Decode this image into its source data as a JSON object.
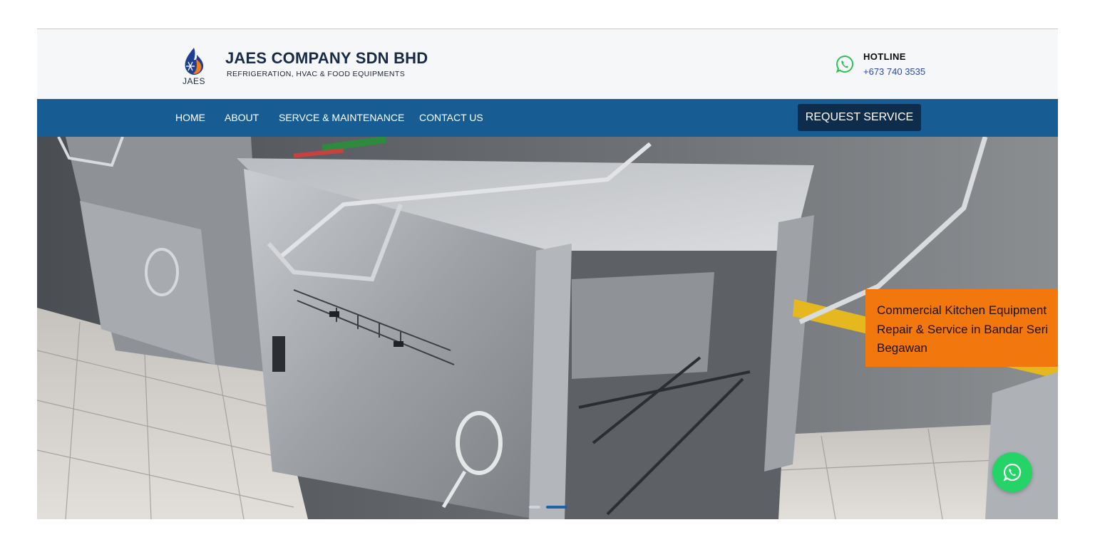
{
  "header": {
    "logo_text": "JAES",
    "company_name": "JAES COMPANY SDN BHD",
    "tagline": "REFRIGERATION, HVAC & FOOD EQUIPMENTS",
    "hotline_label": "HOTLINE",
    "hotline_number": "+673 740 3535"
  },
  "nav": {
    "items": [
      {
        "label": "HOME"
      },
      {
        "label": "ABOUT"
      },
      {
        "label": "SERVCE & MAINTENANCE"
      },
      {
        "label": "CONTACT US"
      }
    ],
    "request_button": "REQUEST SERVICE"
  },
  "hero": {
    "caption": "Commercial Kitchen Equipment Repair & Service in Bandar Seri Begawan",
    "slides_total": 2,
    "active_slide": 2
  },
  "icons": {
    "hotline": "whatsapp-icon",
    "floating": "whatsapp-icon"
  },
  "colors": {
    "nav_background": "#175d94",
    "request_button": "#0e2d4c",
    "caption_background": "#f2780d",
    "whatsapp_green": "#25d366",
    "company_name": "#182a47"
  }
}
